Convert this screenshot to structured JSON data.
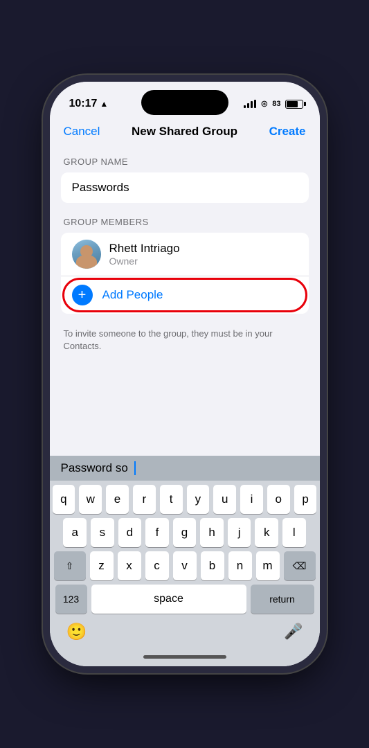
{
  "statusBar": {
    "time": "10:17",
    "battery": "83"
  },
  "navBar": {
    "cancelLabel": "Cancel",
    "title": "New Shared Group",
    "createLabel": "Create"
  },
  "groupNameSection": {
    "label": "GROUP NAME",
    "value": "Passwords"
  },
  "membersSection": {
    "label": "GROUP MEMBERS",
    "owner": {
      "name": "Rhett Intriago",
      "role": "Owner"
    },
    "addPeopleLabel": "Add People"
  },
  "hintText": "To invite someone to the group, they must be in your Contacts.",
  "keyboard": {
    "predictive": "Password so",
    "rows": [
      [
        "q",
        "w",
        "e",
        "r",
        "t",
        "y",
        "u",
        "i",
        "o",
        "p"
      ],
      [
        "a",
        "s",
        "d",
        "f",
        "g",
        "h",
        "j",
        "k",
        "l"
      ],
      [
        "z",
        "x",
        "c",
        "v",
        "b",
        "n",
        "m"
      ],
      [
        "123",
        "space",
        "return"
      ]
    ]
  }
}
